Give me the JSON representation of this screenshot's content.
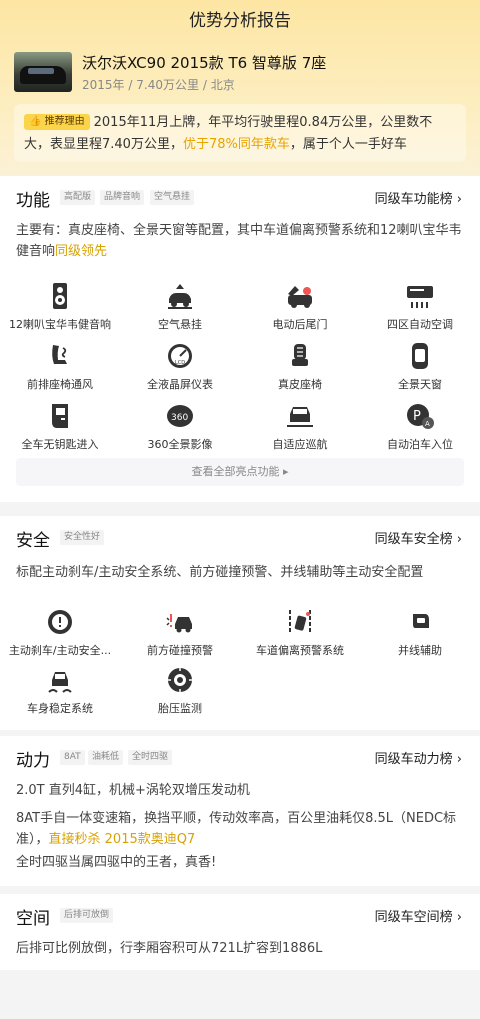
{
  "header": {
    "title": "优势分析报告"
  },
  "car": {
    "title": "沃尔沃XC90 2015款 T6 智尊版 7座",
    "year": "2015年",
    "mileage": "7.40万公里",
    "city": "北京",
    "sep": "/"
  },
  "reason": {
    "tag": "推荐理由",
    "text_a": "2015年11月上牌，年平均行驶里程0.84万公里，公里数不大，表显里程7.40万公里，",
    "highlight": "优于78%同年款车",
    "text_b": "，属于个人一手好车"
  },
  "func": {
    "title": "功能",
    "chips": [
      "高配版",
      "品牌音响",
      "空气悬挂"
    ],
    "rank": "同级车功能榜 ›",
    "desc": "主要有：真皮座椅、全景天窗等配置，其中车道偏离预警系统和12喇叭宝华韦健音响",
    "desc_hl": "同级领先",
    "items": [
      {
        "label": "12喇叭宝华韦健音响",
        "icon": "speaker-icon"
      },
      {
        "label": "空气悬挂",
        "icon": "air-suspension-icon"
      },
      {
        "label": "电动后尾门",
        "icon": "power-tailgate-icon"
      },
      {
        "label": "四区自动空调",
        "icon": "climate-control-icon"
      },
      {
        "label": "前排座椅通风",
        "icon": "seat-ventilation-icon"
      },
      {
        "label": "全液晶屏仪表",
        "icon": "lcd-gauge-icon"
      },
      {
        "label": "真皮座椅",
        "icon": "leather-seat-icon"
      },
      {
        "label": "全景天窗",
        "icon": "panoramic-roof-icon"
      },
      {
        "label": "全车无钥匙进入",
        "icon": "keyless-entry-icon"
      },
      {
        "label": "360全景影像",
        "icon": "camera-360-icon"
      },
      {
        "label": "自适应巡航",
        "icon": "adaptive-cruise-icon"
      },
      {
        "label": "自动泊车入位",
        "icon": "auto-parking-icon"
      }
    ],
    "more": "查看全部亮点功能 ▸"
  },
  "safety": {
    "title": "安全",
    "chips": [
      "安全性好"
    ],
    "rank": "同级车安全榜 ›",
    "desc": "标配主动刹车/主动安全系统、前方碰撞预警、并线辅助等主动安全配置",
    "items": [
      {
        "label": "主动刹车/主动安全...",
        "icon": "active-brake-icon"
      },
      {
        "label": "前方碰撞预警",
        "icon": "collision-warning-icon"
      },
      {
        "label": "车道偏离预警系统",
        "icon": "lane-departure-icon"
      },
      {
        "label": "并线辅助",
        "icon": "blind-spot-icon"
      },
      {
        "label": "车身稳定系统",
        "icon": "stability-control-icon"
      },
      {
        "label": "胎压监测",
        "icon": "tire-pressure-icon"
      }
    ]
  },
  "power": {
    "title": "动力",
    "chips": [
      "8AT",
      "油耗低",
      "全时四驱"
    ],
    "rank": "同级车动力榜 ›",
    "line1": "2.0T 直列4缸，机械+涡轮双增压发动机",
    "line2": "8AT手自一体变速箱，换挡平顺，传动效率高，百公里油耗仅8.5L（NEDC标准），",
    "line2_hl": "直接秒杀 2015款奥迪Q7",
    "line3": "全时四驱当属四驱中的王者，真香!"
  },
  "space": {
    "title": "空间",
    "chips": [
      "后排可放倒"
    ],
    "rank": "同级车空间榜 ›",
    "desc": "后排可比例放倒，行李厢容积可从721L扩容到1886L"
  },
  "colors": {
    "accent": "#fbd44a",
    "highlight": "#e7a400"
  }
}
